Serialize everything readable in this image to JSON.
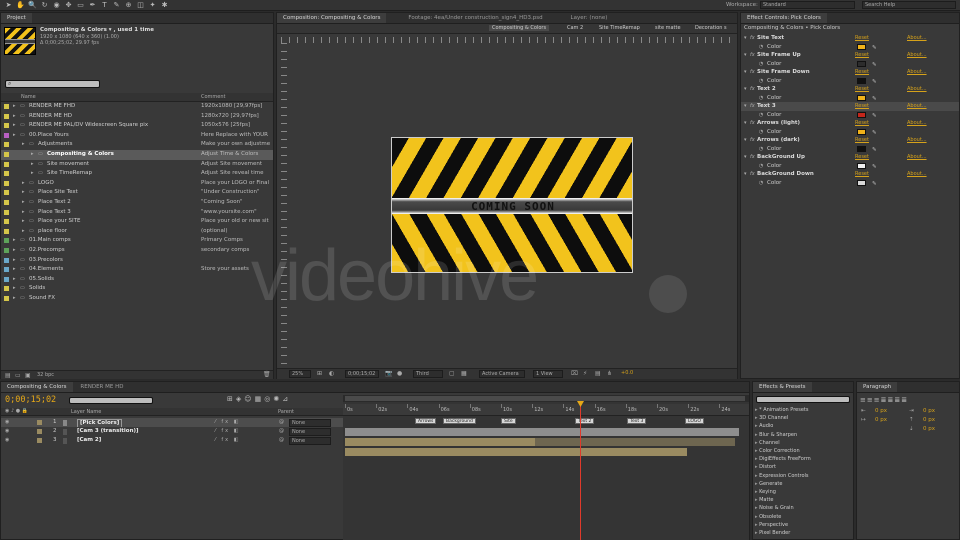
{
  "app_toolbar": {
    "workspace_label": "Workspace:",
    "workspace_value": "Standard",
    "search_placeholder": "Search Help"
  },
  "project": {
    "tab": "Project",
    "comp_name": "Compositing & Colors ▾ , used 1 time",
    "comp_info_1": "1920 x 1080 (640 x 360) (1.00)",
    "comp_info_2": "Δ 0;00;25;02, 29.97 fps",
    "col_name": "Name",
    "col_comment": "Comment",
    "bpc": "32 bpc",
    "items": [
      {
        "indent": 0,
        "name": "RENDER ME FHD",
        "comment": "1920x1080 [29,97fps]",
        "color": "#d4c64a"
      },
      {
        "indent": 0,
        "name": "RENDER ME HD",
        "comment": "1280x720 [29,97fps]",
        "color": "#d4c64a"
      },
      {
        "indent": 0,
        "name": "RENDER ME PAL/DV Widescreen Square pix",
        "comment": "1050x576 [25fps]",
        "color": "#d4c64a"
      },
      {
        "indent": 0,
        "name": "00.Place Yours",
        "comment": "Here Replace with YOUR",
        "color": "#b85fc2"
      },
      {
        "indent": 1,
        "name": "Adjustments",
        "comment": "Make your own adjustme",
        "color": "#d4c64a"
      },
      {
        "indent": 2,
        "name": "Compositing & Colors",
        "comment": "Adjust Time & Colors",
        "color": "#d4c64a",
        "selected": true
      },
      {
        "indent": 2,
        "name": "Site movement",
        "comment": "Adjust Site movement",
        "color": "#d4c64a"
      },
      {
        "indent": 2,
        "name": "Site TimeRemap",
        "comment": "Adjust Site reveal time",
        "color": "#d4c64a"
      },
      {
        "indent": 1,
        "name": "LOGO",
        "comment": "Place your LOGO or Final",
        "color": "#d4c64a"
      },
      {
        "indent": 1,
        "name": "Place Site Text",
        "comment": "\"Under Construction\"",
        "color": "#d4c64a"
      },
      {
        "indent": 1,
        "name": "Place Text 2",
        "comment": "\"Coming Soon\"",
        "color": "#d4c64a"
      },
      {
        "indent": 1,
        "name": "Place Text 3",
        "comment": "\"www.yoursite.com\"",
        "color": "#d4c64a"
      },
      {
        "indent": 1,
        "name": "Place your SITE",
        "comment": "Place your old or new sit",
        "color": "#d4c64a"
      },
      {
        "indent": 1,
        "name": "place floor",
        "comment": "(optional)",
        "color": "#d4c64a"
      },
      {
        "indent": 0,
        "name": "01.Main comps",
        "comment": "Primary Comps",
        "color": "#5ea35a"
      },
      {
        "indent": 0,
        "name": "02.Precomps",
        "comment": "secondary comps",
        "color": "#5ea35a"
      },
      {
        "indent": 0,
        "name": "03.Precolors",
        "comment": "",
        "color": "#6aa8c9"
      },
      {
        "indent": 0,
        "name": "04.Elements",
        "comment": "Store your assets",
        "color": "#6aa8c9"
      },
      {
        "indent": 0,
        "name": "05.Solids",
        "comment": "",
        "color": "#6aa8c9"
      },
      {
        "indent": 0,
        "name": "Solids",
        "comment": "",
        "color": "#d4c64a"
      },
      {
        "indent": 0,
        "name": "Sound FX",
        "comment": "",
        "color": "#d4c64a"
      }
    ]
  },
  "viewer": {
    "tabs": [
      "Composition: Compositing & Colors",
      "Footage: 4ea/Under construction_sign4_HD3.psd",
      "Layer: (none)"
    ],
    "subtabs": [
      "Compositing & Colors",
      "Cam 2",
      "Site TimeRemap",
      "site matte",
      "Decoration s"
    ],
    "banner_text": "COMING SOON",
    "zoom": "25%",
    "timecode": "0;00;15;02",
    "resolution": "Third",
    "camera": "Active Camera",
    "views": "1 View",
    "exposure": "+0.0",
    "watermark": "videohive"
  },
  "effect_controls": {
    "tab": "Effect Controls: Pick Colors",
    "path": "Compositing & Colors • Pick Colors",
    "reset": "Reset",
    "about": "About...",
    "effects": [
      {
        "name": "Site Text",
        "sub": "Color",
        "color": "#f0b21a"
      },
      {
        "name": "Site Frame Up",
        "sub": "Color",
        "color": "#2c2c2c"
      },
      {
        "name": "Site Frame Down",
        "sub": "Color",
        "color": "#111111"
      },
      {
        "name": "Text 2",
        "sub": "Color",
        "color": "#f0b21a"
      },
      {
        "name": "Text 3",
        "sub": "Color",
        "color": "#c4261b",
        "selected": true
      },
      {
        "name": "Arrows (light)",
        "sub": "Color",
        "color": "#f0b21a"
      },
      {
        "name": "Arrows (dark)",
        "sub": "Color",
        "color": "#111111"
      },
      {
        "name": "BackGround Up",
        "sub": "Color",
        "color": "#eeeeee"
      },
      {
        "name": "BackGround Down",
        "sub": "Color",
        "color": "#d8d8d8"
      }
    ]
  },
  "timeline": {
    "tabs": [
      "Compositing & Colors",
      "RENDER ME HD"
    ],
    "timecode": "0;00;15;02",
    "col_layer": "Layer Name",
    "col_parent": "Parent",
    "layers": [
      {
        "num": "1",
        "name": "[Pick Colors]",
        "parent": "None"
      },
      {
        "num": "2",
        "name": "[Cam 3 (transition)]",
        "parent": "None"
      },
      {
        "num": "3",
        "name": "[Cam 2]",
        "parent": "None"
      }
    ],
    "ruler": [
      "0s",
      "02s",
      "04s",
      "06s",
      "08s",
      "10s",
      "12s",
      "14s",
      "16s",
      "18s",
      "20s",
      "22s",
      "24s"
    ],
    "markers": [
      "Arrows",
      "Background",
      "Site",
      "Text 2",
      "Text 3",
      "LOGO"
    ]
  },
  "effects_presets": {
    "tab": "Effects & Presets",
    "items": [
      "* Animation Presets",
      "3D Channel",
      "Audio",
      "Blur & Sharpen",
      "Channel",
      "Color Correction",
      "DigiEffects FreeForm",
      "Distort",
      "Expression Controls",
      "Generate",
      "Keying",
      "Matte",
      "Noise & Grain",
      "Obsolete",
      "Perspective",
      "Pixel Bender"
    ]
  },
  "paragraph": {
    "tab": "Paragraph",
    "fields": [
      "0 px",
      "0 px",
      "0 px",
      "0 px",
      "0 px"
    ]
  }
}
